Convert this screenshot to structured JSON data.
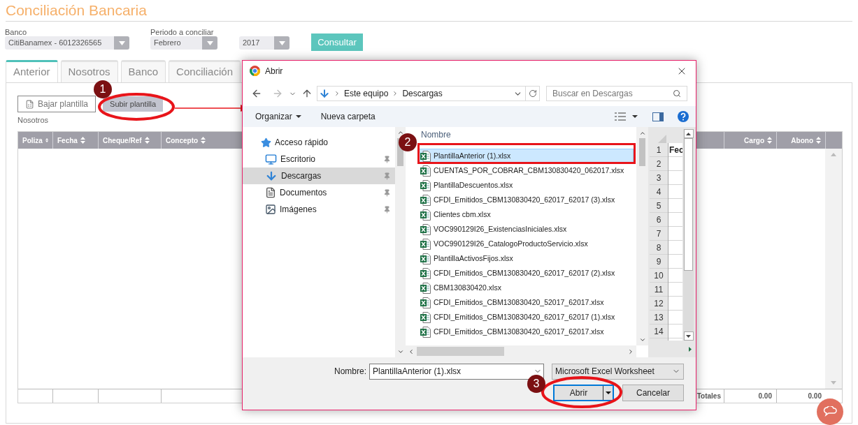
{
  "page": {
    "title": "Conciliación Bancaria"
  },
  "filters": [
    {
      "label": "Banco",
      "value": "CitiBanamex - 6012326565"
    },
    {
      "label": "Periodo a conciliar",
      "value": "Febrero"
    },
    {
      "value": "2017"
    }
  ],
  "consult_button": "Consultar",
  "tabs": [
    {
      "label": "Anterior",
      "selected": true
    },
    {
      "label": "Nosotros",
      "selected": false
    },
    {
      "label": "Banco",
      "selected": false
    },
    {
      "label": "Conciliación",
      "selected": false
    }
  ],
  "actions": [
    {
      "label": "Bajar plantilla",
      "kind": "download"
    },
    {
      "label": "Subir plantilla",
      "kind": "upload"
    }
  ],
  "section_label": "Nosotros",
  "table": {
    "columns": [
      {
        "label": "Poliza"
      },
      {
        "label": "Fecha"
      },
      {
        "label": "Cheque/Ref"
      },
      {
        "label": "Concepto"
      },
      {
        "label": "Cargo"
      },
      {
        "label": "Abono"
      }
    ],
    "footer": {
      "label": "Totales",
      "cargo": "0.00",
      "abono": "0.00"
    }
  },
  "dialog": {
    "title": "Abrir",
    "path": [
      "Este equipo",
      "Descargas"
    ],
    "search_placeholder": "Buscar en Descargas",
    "toolbar": [
      "Organizar",
      "Nueva carpeta"
    ],
    "nav": [
      {
        "label": "Acceso rápido",
        "kind": "star",
        "selected": false,
        "pinned": false
      },
      {
        "label": "Escritorio",
        "kind": "desktop",
        "selected": false,
        "pinned": true
      },
      {
        "label": "Descargas",
        "kind": "download",
        "selected": true,
        "pinned": true
      },
      {
        "label": "Documentos",
        "kind": "document",
        "selected": false,
        "pinned": true
      },
      {
        "label": "Imágenes",
        "kind": "images",
        "selected": false,
        "pinned": true
      }
    ],
    "files_header": "Nombre",
    "files": [
      {
        "name": "PlantillaAnterior (1).xlsx",
        "selected": true
      },
      {
        "name": "CUENTAS_POR_COBRAR_CBM130830420_062017.xlsx",
        "selected": false
      },
      {
        "name": "PlantillaDescuentos.xlsx",
        "selected": false
      },
      {
        "name": "CFDI_Emitidos_CBM130830420_62017_62017 (3).xlsx",
        "selected": false
      },
      {
        "name": "Clientes cbm.xlsx",
        "selected": false
      },
      {
        "name": "VOC990129I26_ExistenciasIniciales.xlsx",
        "selected": false
      },
      {
        "name": "VOC990129I26_CatalogoProductoServicio.xlsx",
        "selected": false
      },
      {
        "name": "PlantillaActivosFijos.xlsx",
        "selected": false
      },
      {
        "name": "CFDI_Emitidos_CBM130830420_62017_62017 (2).xlsx",
        "selected": false
      },
      {
        "name": "CBM130830420.xlsx",
        "selected": false
      },
      {
        "name": "CFDI_Emitidos_CBM130830420_52017_62017.xlsx",
        "selected": false
      },
      {
        "name": "CFDI_Emitidos_CBM130830420_62017_62017 (1).xlsx",
        "selected": false
      },
      {
        "name": "CFDI_Emitidos_CBM130830420_62017_62017.xlsx",
        "selected": false
      }
    ],
    "preview": {
      "header": "Fec",
      "rows": [
        "1",
        "2",
        "3",
        "4",
        "5",
        "6",
        "7",
        "8",
        "9",
        "10",
        "11",
        "12",
        "13",
        "14"
      ]
    },
    "filename_label": "Nombre:",
    "filename": "PlantillaAnterior (1).xlsx",
    "filetype": "Microsoft Excel Worksheet",
    "open_button": "Abrir",
    "cancel_button": "Cancelar"
  },
  "annotations": [
    {
      "number": "1"
    },
    {
      "number": "2"
    },
    {
      "number": "3"
    }
  ]
}
